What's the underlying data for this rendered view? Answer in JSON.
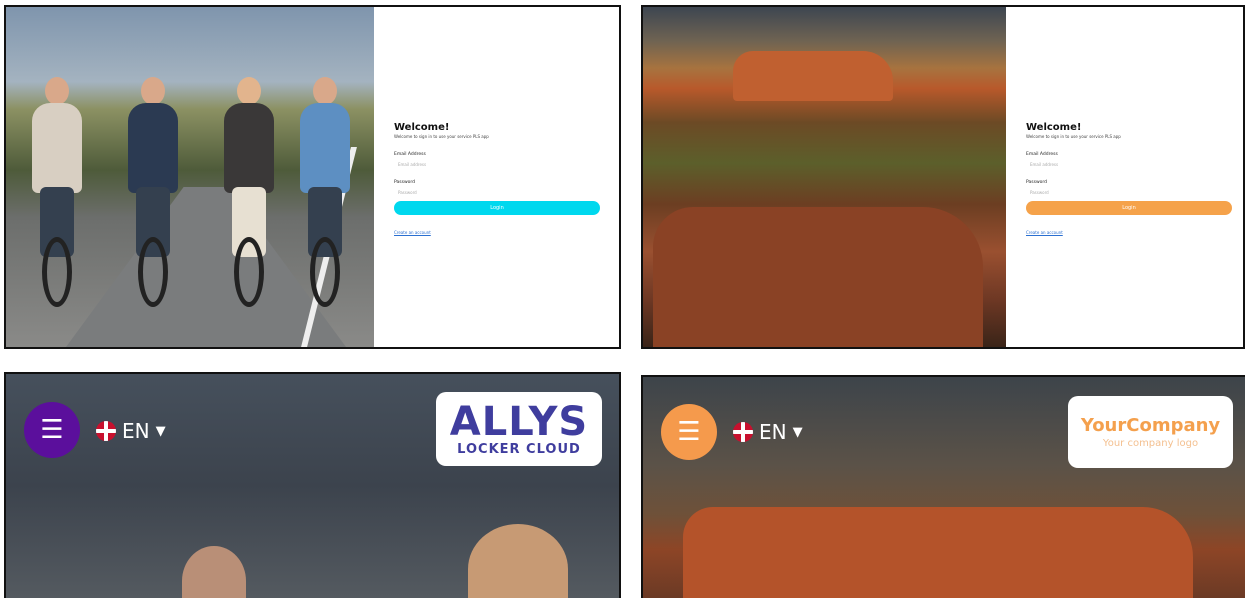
{
  "login": {
    "welcome": "Welcome!",
    "subtitle": "Welcome to sign in to use your service PLS app",
    "email_label": "Email Address",
    "email_placeholder": "Email address",
    "password_label": "Password",
    "password_placeholder": "Password",
    "login_label": "Login",
    "link_label": "Create an account"
  },
  "mobile": {
    "language": "EN",
    "logo_allys_main": "ALLYS",
    "logo_allys_sub": "LOCKER CLOUD",
    "logo_company_main": "YourCompany",
    "logo_company_sub": "Your company logo"
  },
  "theme": {
    "cyan_button": "#00d8ee",
    "orange_button": "#f5a24a",
    "purple_menu": "#5b0f9c",
    "orange_menu": "#f59a4c"
  },
  "icons": {
    "menu": "hamburger-icon",
    "flag": "uk-flag-icon",
    "caret": "caret-down-icon"
  }
}
